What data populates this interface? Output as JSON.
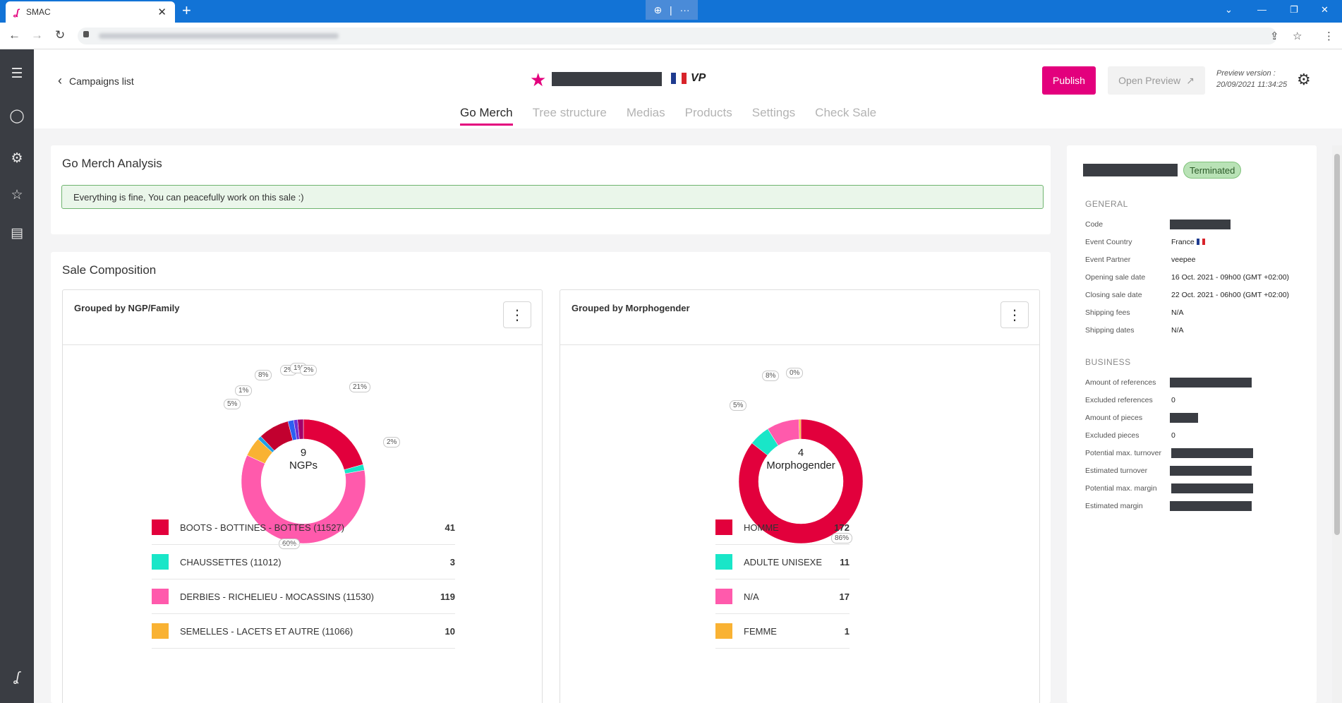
{
  "browser": {
    "tab_title": "SMAC",
    "tab_logo": "ʆ",
    "close_glyph": "✕",
    "new_tab_glyph": "+",
    "zoom_glyph": "⊕",
    "sep_glyph": "|",
    "dots_glyph": "···"
  },
  "header": {
    "back_label": "Campaigns list",
    "vp_label": "VP",
    "publish_label": "Publish",
    "open_preview_label": "Open Preview",
    "preview_version_label": "Preview version :",
    "preview_version_date": "20/09/2021 11:34:25",
    "flag_colors": [
      "#1f3b8f",
      "#ffffff",
      "#d8232a"
    ],
    "tabs": [
      "Go Merch",
      "Tree structure",
      "Medias",
      "Products",
      "Settings",
      "Check Sale"
    ],
    "active_tab": "Go Merch"
  },
  "analysis": {
    "title": "Go Merch Analysis",
    "alert_text": "Everything is fine, You can peacefully work on this sale :)"
  },
  "composition": {
    "title": "Sale Composition",
    "ngp_card": {
      "title": "Grouped by NGP/Family",
      "center_value": "9",
      "center_label": "NGPs",
      "pct_labels": [
        "21%",
        "2%",
        "60%",
        "5%",
        "1%",
        "8%",
        "2%",
        "1%",
        "2%"
      ],
      "legend": [
        {
          "label": "BOOTS - BOTTINES - BOTTES (11527)",
          "value": "41"
        },
        {
          "label": "CHAUSSETTES (11012)",
          "value": "3"
        },
        {
          "label": "DERBIES - RICHELIEU - MOCASSINS (11530)",
          "value": "119"
        },
        {
          "label": "SEMELLES - LACETS ET AUTRE (11066)",
          "value": "10"
        }
      ]
    },
    "morpho_card": {
      "title": "Grouped by Morphogender",
      "center_value": "4",
      "center_label": "Morphogender",
      "pct_labels": [
        "86%",
        "5%",
        "8%",
        "0%"
      ],
      "legend": [
        {
          "label": "HOMME",
          "value": "172"
        },
        {
          "label": "ADULTE UNISEXE",
          "value": "11"
        },
        {
          "label": "N/A",
          "value": "17"
        },
        {
          "label": "FEMME",
          "value": "1"
        }
      ]
    }
  },
  "chart_data": [
    {
      "type": "pie",
      "title": "Grouped by NGP/Family",
      "categories": [
        "BOOTS - BOTTINES - BOTTES (11527)",
        "CHAUSSETTES (11012)",
        "DERBIES - RICHELIEU - MOCASSINS (11530)",
        "SEMELLES - LACETS ET AUTRE (11066)",
        "",
        "",
        "",
        "",
        ""
      ],
      "values": [
        41,
        3,
        119,
        10,
        2,
        16,
        3,
        2,
        3
      ],
      "percent_labels": [
        "21%",
        "2%",
        "60%",
        "5%",
        "1%",
        "8%",
        "2%",
        "1%",
        "2%"
      ],
      "colors": [
        "#e2003c",
        "#19e6c8",
        "#ff5aac",
        "#f9b233",
        "#1fa0e6",
        "#c2002f",
        "#2c5ff2",
        "#6a2fd6",
        "#a3006b"
      ]
    },
    {
      "type": "pie",
      "title": "Grouped by Morphogender",
      "categories": [
        "HOMME",
        "ADULTE UNISEXE",
        "N/A",
        "FEMME"
      ],
      "values": [
        172,
        11,
        17,
        1
      ],
      "percent_labels": [
        "86%",
        "5%",
        "8%",
        "0%"
      ],
      "colors": [
        "#e2003c",
        "#19e6c8",
        "#ff5aac",
        "#f9b233"
      ]
    }
  ],
  "right_panel": {
    "status": "Terminated",
    "general_title": "GENERAL",
    "general": [
      {
        "k": "Code",
        "v": ""
      },
      {
        "k": "Event Country",
        "v": "France"
      },
      {
        "k": "Event Partner",
        "v": "veepee"
      },
      {
        "k": "Opening sale date",
        "v": "16 Oct. 2021 - 09h00 (GMT +02:00)"
      },
      {
        "k": "Closing sale date",
        "v": "22 Oct. 2021 - 06h00 (GMT +02:00)"
      },
      {
        "k": "Shipping fees",
        "v": "N/A"
      },
      {
        "k": "Shipping dates",
        "v": "N/A"
      }
    ],
    "business_title": "BUSINESS",
    "business": [
      {
        "k": "Amount of references",
        "v": ""
      },
      {
        "k": "Excluded references",
        "v": "0"
      },
      {
        "k": "Amount of pieces",
        "v": ""
      },
      {
        "k": "Excluded pieces",
        "v": "0"
      },
      {
        "k": "Potential max. turnover",
        "v": ""
      },
      {
        "k": "Estimated turnover",
        "v": ""
      },
      {
        "k": "Potential max. margin",
        "v": ""
      },
      {
        "k": "Estimated margin",
        "v": ""
      }
    ]
  },
  "icons": {
    "menu": "☰",
    "user": "◯",
    "settings": "⚙",
    "star": "☆",
    "stack": "▤",
    "brand": "ʆ",
    "back": "‹",
    "reload": "↻",
    "forward": "→",
    "arrow_back": "←",
    "share": "⇪",
    "bookmark": "☆",
    "kebab": "⋮",
    "external": "↗",
    "title_star": "★"
  }
}
